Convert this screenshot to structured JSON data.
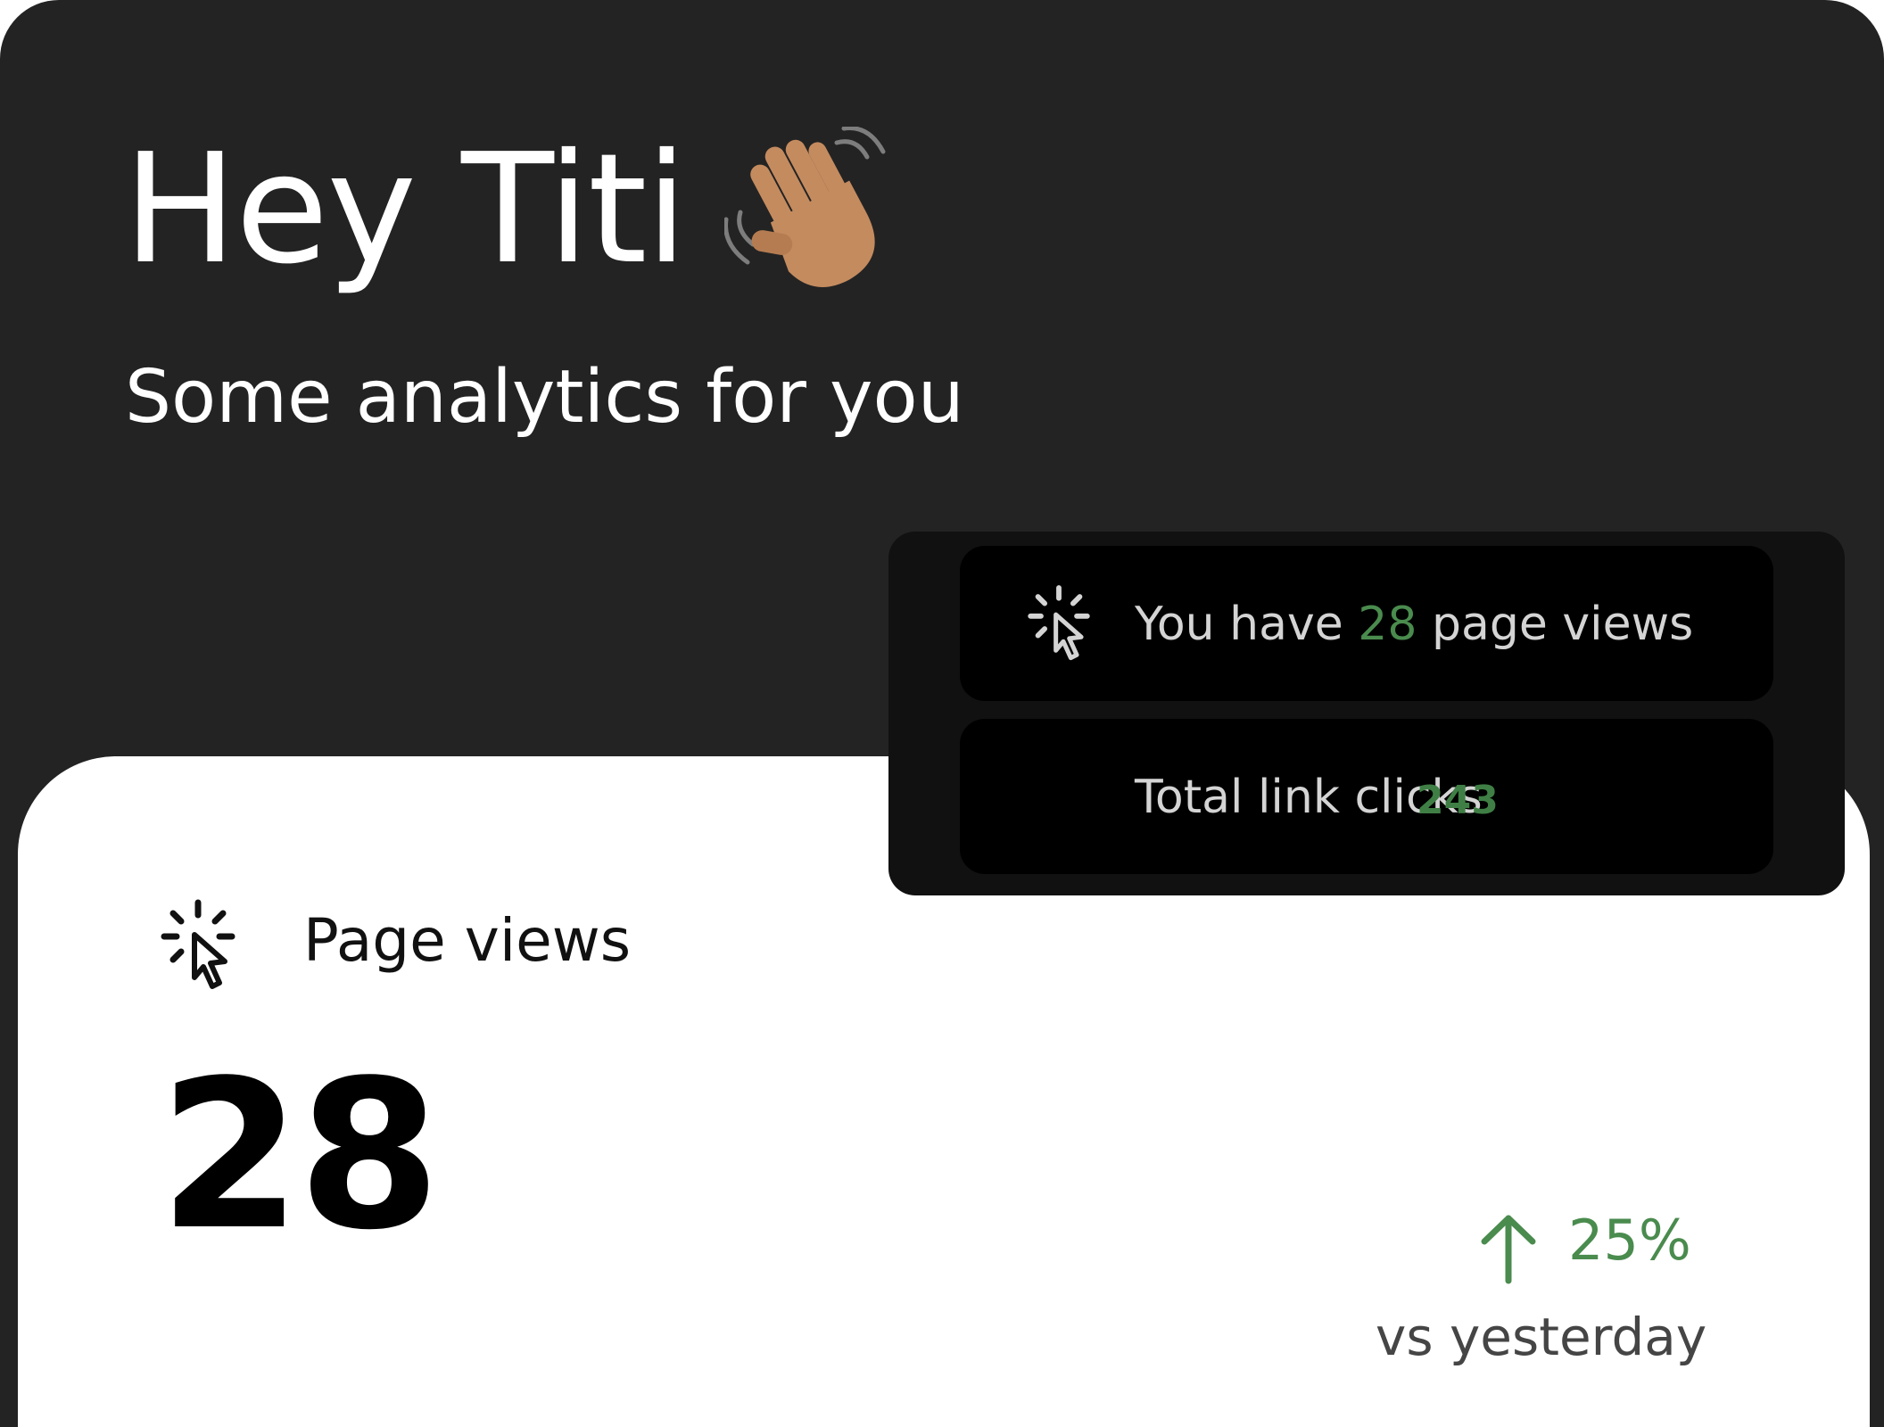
{
  "header": {
    "greeting": "Hey Titi",
    "subtitle": "Some analytics for you",
    "wave_icon": "waving-hand-icon"
  },
  "summary_popup": {
    "page_views_prefix": "You have ",
    "page_views_count": "28",
    "page_views_suffix": " page views",
    "link_clicks_label": "Total link clicks",
    "link_clicks_count": "243",
    "icon": "cursor-click-icon"
  },
  "page_views_card": {
    "label": "Page views",
    "value": "28",
    "icon": "cursor-click-icon",
    "trend": {
      "direction": "up",
      "percent": "25%",
      "comparison": "vs yesterday",
      "icon": "arrow-up-icon"
    }
  },
  "colors": {
    "background": "#232323",
    "panel": "#ffffff",
    "positive": "#4a8b4e",
    "popup": "#111111",
    "popup_row": "#000000"
  }
}
